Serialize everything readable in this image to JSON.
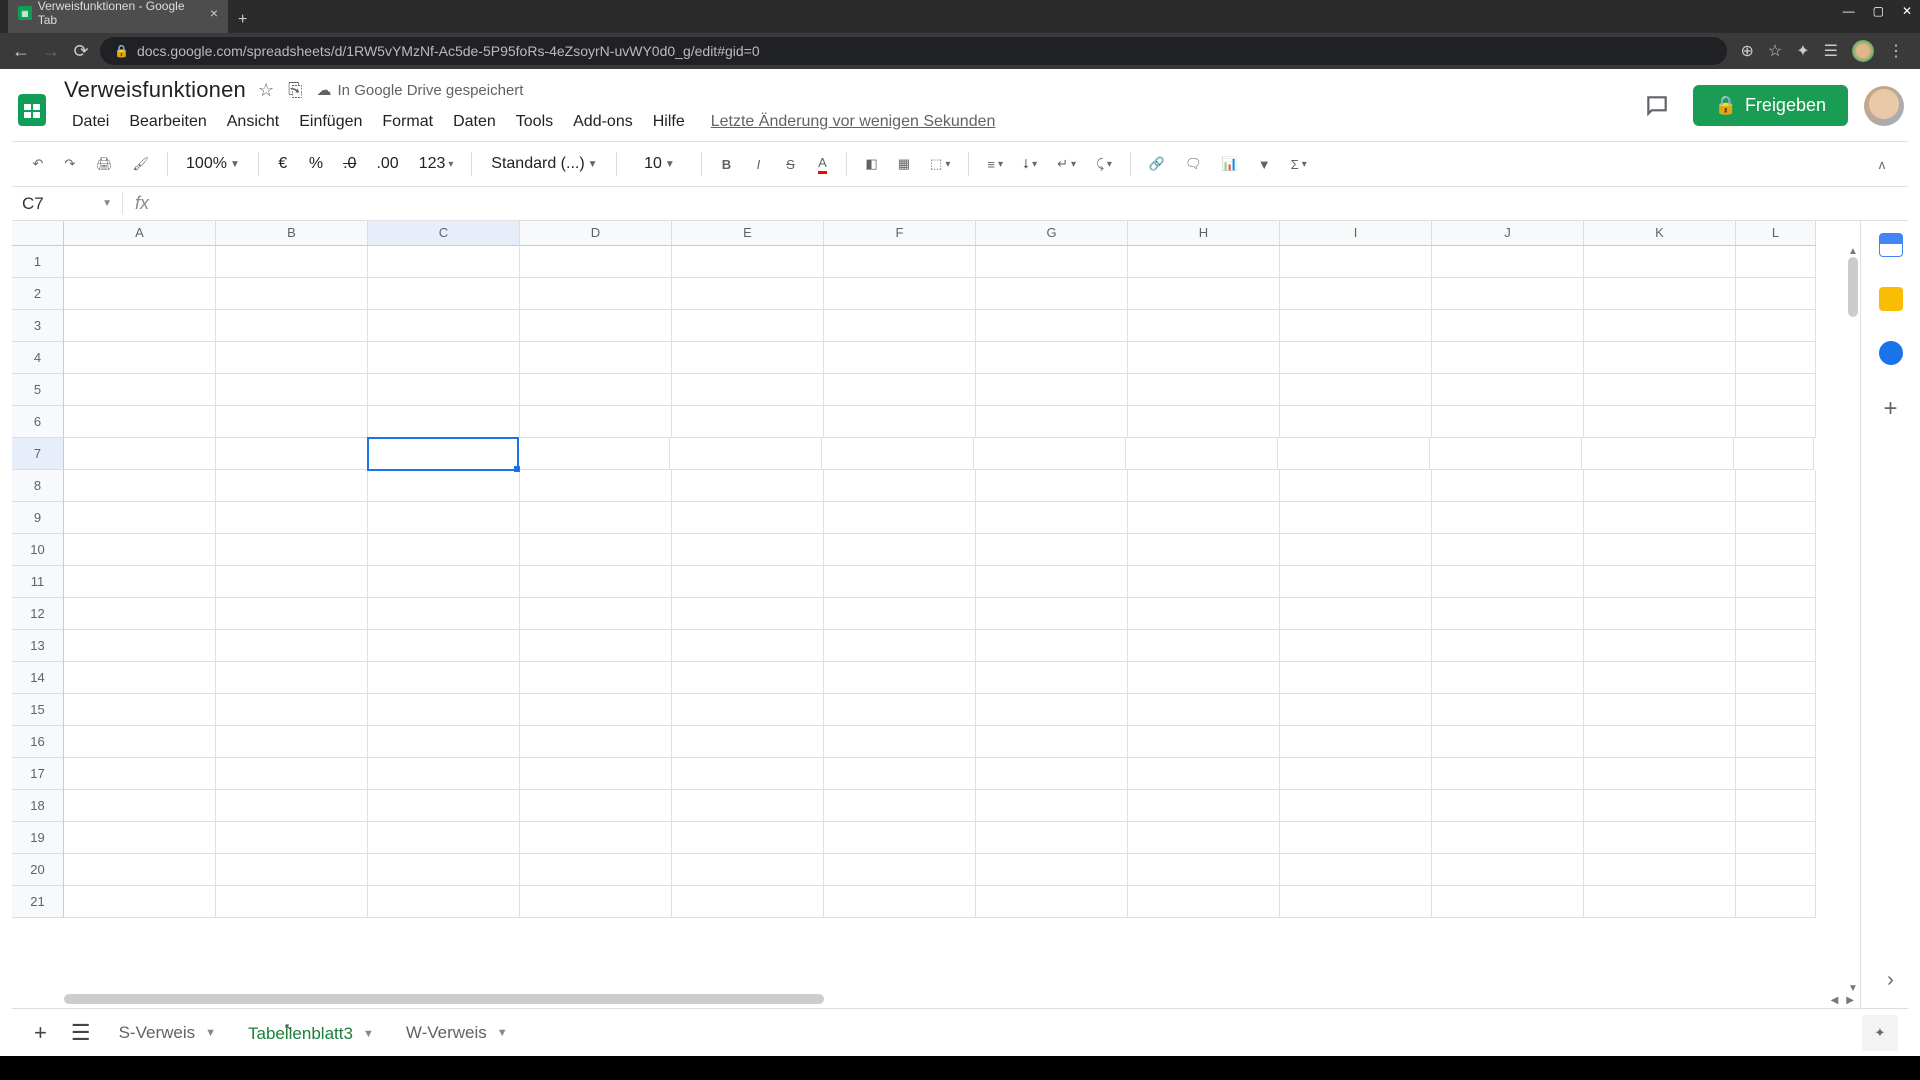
{
  "browser": {
    "tab_title": "Verweisfunktionen - Google Tab",
    "url": "docs.google.com/spreadsheets/d/1RW5vYMzNf-Ac5de-5P95foRs-4eZsoyrN-uvWY0d0_g/edit#gid=0"
  },
  "doc": {
    "title": "Verweisfunktionen",
    "save_status": "In Google Drive gespeichert",
    "last_edit": "Letzte Änderung vor wenigen Sekunden",
    "share_label": "Freigeben"
  },
  "menus": {
    "file": "Datei",
    "edit": "Bearbeiten",
    "view": "Ansicht",
    "insert": "Einfügen",
    "format": "Format",
    "data": "Daten",
    "tools": "Tools",
    "addons": "Add-ons",
    "help": "Hilfe"
  },
  "toolbar": {
    "zoom": "100%",
    "currency": "€",
    "percent": "%",
    "dec_dec": ".0",
    "inc_dec": ".00",
    "more_formats": "123",
    "font": "Standard (...)",
    "font_size": "10"
  },
  "name_box": "C7",
  "columns": [
    "A",
    "B",
    "C",
    "D",
    "E",
    "F",
    "G",
    "H",
    "I",
    "J",
    "K",
    "L"
  ],
  "rows": [
    "1",
    "2",
    "3",
    "4",
    "5",
    "6",
    "7",
    "8",
    "9",
    "10",
    "11",
    "12",
    "13",
    "14",
    "15",
    "16",
    "17",
    "18",
    "19",
    "20",
    "21"
  ],
  "active_cell": {
    "col": 2,
    "row": 6
  },
  "sheet_tabs": [
    {
      "name": "S-Verweis",
      "active": false
    },
    {
      "name": "Tabellenblatt3",
      "active": true
    },
    {
      "name": "W-Verweis",
      "active": false
    }
  ]
}
